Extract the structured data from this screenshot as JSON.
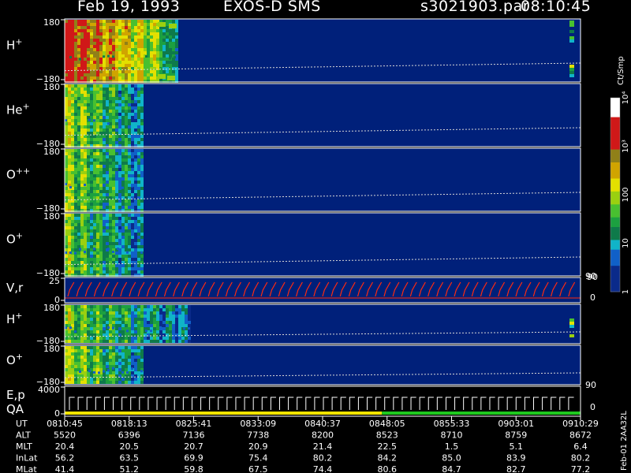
{
  "header": {
    "date": "Feb 19, 1993",
    "instrument": "EXOS-D SMS",
    "file": "s3021903.par",
    "time": "08:10:45"
  },
  "colorbar": {
    "unit": "Ct/Smp",
    "ticks": [
      "1",
      "10",
      "100",
      "10³",
      "10⁴"
    ]
  },
  "footer_id": "Feb-01 2AA32L",
  "colors": {
    "background_field": "#00207a",
    "axis": "#ffffff",
    "vel_trace": "#ff2a10",
    "qa_yellow": "#f2e400",
    "qa_green": "#1ec81e"
  },
  "chart_data": {
    "type": "heatmap",
    "title": "Feb 19, 1993   EXOS-D SMS",
    "panels": [
      {
        "label": "H",
        "sup": "+",
        "ytop": "180",
        "ybot": "−180",
        "active_fraction": 0.22,
        "late_spike": true,
        "peak_level": 3.3
      },
      {
        "label": "He",
        "sup": "+",
        "ytop": "180",
        "ybot": "−180",
        "active_fraction": 0.15,
        "late_spike": false,
        "peak_level": 2.0
      },
      {
        "label": "O",
        "sup": "++",
        "ytop": "180",
        "ybot": "−180",
        "active_fraction": 0.15,
        "late_spike": false,
        "peak_level": 1.9
      },
      {
        "label": "O",
        "sup": "+",
        "ytop": "180",
        "ybot": "−180",
        "active_fraction": 0.15,
        "late_spike": false,
        "peak_level": 1.8,
        "right_tick": "90"
      },
      {
        "label": "V,r",
        "sup": "",
        "ytop": "25",
        "ybot": "0",
        "right_ticks": [
          "90",
          "0"
        ],
        "line_plot": true
      },
      {
        "label": "H",
        "sup": "+",
        "ytop": "180",
        "ybot": "−180",
        "active_fraction": 0.24,
        "late_spike": true,
        "peak_level": 1.8
      },
      {
        "label": "O",
        "sup": "+",
        "ytop": "180",
        "ybot": "−180",
        "active_fraction": 0.15,
        "late_spike": false,
        "peak_level": 2.0,
        "right_tick": "90"
      },
      {
        "label": "E,p",
        "label2": "QA",
        "sup": "",
        "ytop": "4000",
        "ybot": "0",
        "right_ticks": [
          "0"
        ],
        "qa_bar": true
      }
    ],
    "colorbar_range_log": [
      0,
      4
    ],
    "orbit_table": {
      "rows": [
        {
          "name": "UT",
          "values": [
            "0810:45",
            "0818:13",
            "0825:41",
            "0833:09",
            "0840:37",
            "0848:05",
            "0855:33",
            "0903:01",
            "0910:29"
          ]
        },
        {
          "name": "ALT",
          "values": [
            "5520",
            "6396",
            "7136",
            "7738",
            "8200",
            "8523",
            "8710",
            "8759",
            "8672"
          ]
        },
        {
          "name": "MLT",
          "values": [
            "20.4",
            "20.5",
            "20.7",
            "20.9",
            "21.4",
            "22.5",
            "1.5",
            "5.1",
            "6.4"
          ]
        },
        {
          "name": "InLat",
          "values": [
            "56.2",
            "63.5",
            "69.9",
            "75.4",
            "80.2",
            "84.2",
            "85.0",
            "83.9",
            "80.2"
          ]
        },
        {
          "name": "MLat",
          "values": [
            "41.4",
            "51.2",
            "59.8",
            "67.5",
            "74.4",
            "80.6",
            "84.7",
            "82.7",
            "77.2"
          ]
        }
      ]
    }
  }
}
